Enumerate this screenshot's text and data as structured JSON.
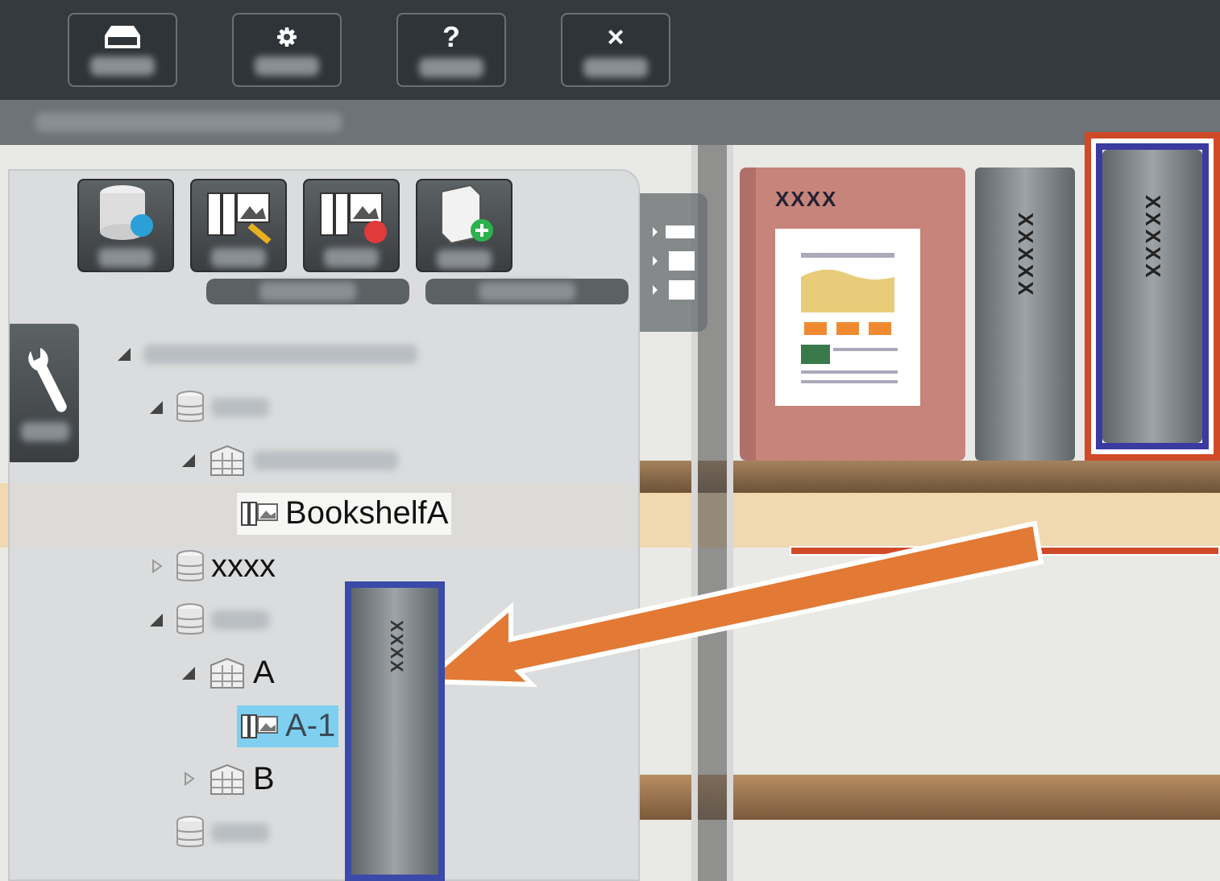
{
  "toolbar": [
    {
      "kind": "tray"
    },
    {
      "kind": "gear"
    },
    {
      "kind": "glyph",
      "glyph": "?"
    },
    {
      "kind": "glyph",
      "glyph": "×"
    }
  ],
  "panel_tools": [
    {
      "kind": "database-sync"
    },
    {
      "kind": "binder-edit"
    },
    {
      "kind": "binder-delete"
    },
    {
      "kind": "book-add"
    }
  ],
  "tree": [
    {
      "kind": "root",
      "expanded": true,
      "selected": false,
      "children": [
        {
          "kind": "database",
          "expanded": true,
          "selected": false,
          "children": [
            {
              "kind": "shelf",
              "expanded": true,
              "selected": false,
              "children": [
                {
                  "kind": "binder",
                  "label": "BookshelfA",
                  "selected": false
                }
              ]
            }
          ]
        },
        {
          "kind": "database",
          "label": "xxxx",
          "expanded": false,
          "selected": false
        },
        {
          "kind": "database",
          "expanded": true,
          "selected": false,
          "children": [
            {
              "kind": "shelf",
              "label": "A",
              "expanded": true,
              "selected": false,
              "children": [
                {
                  "kind": "binder",
                  "label": "A-1",
                  "selected": true
                }
              ]
            },
            {
              "kind": "shelf",
              "label": "B",
              "expanded": false,
              "selected": false
            }
          ]
        },
        {
          "kind": "database",
          "selected": false
        }
      ]
    }
  ],
  "books": [
    {
      "kind": "cover",
      "title": "XXXX",
      "highlighted": false
    },
    {
      "kind": "spine",
      "title": "XXXXX",
      "highlighted": false
    },
    {
      "kind": "spine",
      "title": "XXXXX",
      "highlighted": true
    }
  ],
  "dragged_book": {
    "title": "XXXX"
  }
}
